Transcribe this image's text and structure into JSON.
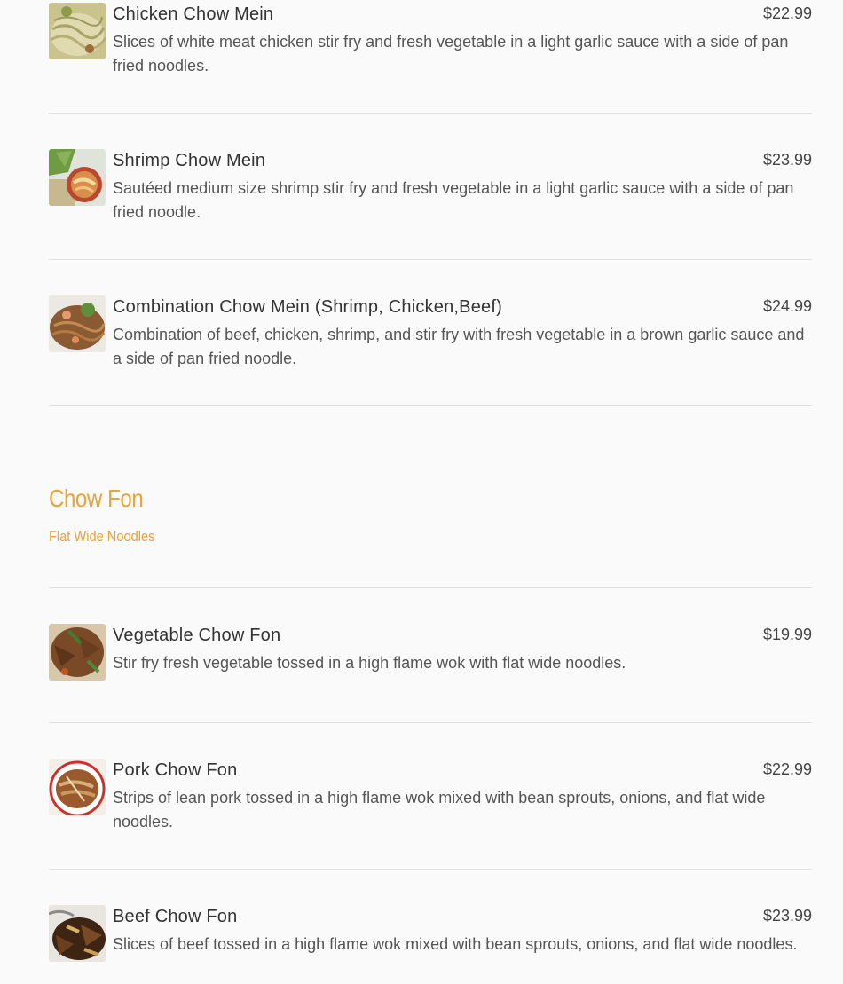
{
  "items_top": [
    {
      "name": "Chicken Chow Mein",
      "price": "$22.99",
      "description": "Slices of white meat chicken stir fry and fresh vegetable in a light garlic sauce with a side of pan fried noodles."
    },
    {
      "name": "Shrimp Chow Mein",
      "price": "$23.99",
      "description": "Sautéed medium size shrimp stir fry and fresh vegetable in a light garlic sauce with a side of pan fried noodle."
    },
    {
      "name": "Combination Chow Mein (Shrimp, Chicken,Beef)",
      "price": "$24.99",
      "description": "Combination of beef, chicken, shrimp, and stir fry with fresh vegetable in a brown garlic sauce and a side of pan fried noodle."
    }
  ],
  "section": {
    "title": "Chow Fon",
    "subtitle": "Flat Wide Noodles"
  },
  "items_bottom": [
    {
      "name": "Vegetable Chow Fon",
      "price": "$19.99",
      "description": "Stir fry fresh vegetable tossed in a high flame wok with flat wide noodles."
    },
    {
      "name": "Pork Chow Fon",
      "price": "$22.99",
      "description": "Strips of lean pork tossed in a high flame wok mixed with bean sprouts, onions, and flat wide noodles."
    },
    {
      "name": "Beef Chow Fon",
      "price": "$23.99",
      "description": "Slices of beef tossed in a high flame wok mixed with bean sprouts, onions, and flat wide noodles."
    }
  ],
  "colors": {
    "accent": "#e8a33a",
    "divider": "#e1e1e1",
    "background": "#fafafa"
  }
}
